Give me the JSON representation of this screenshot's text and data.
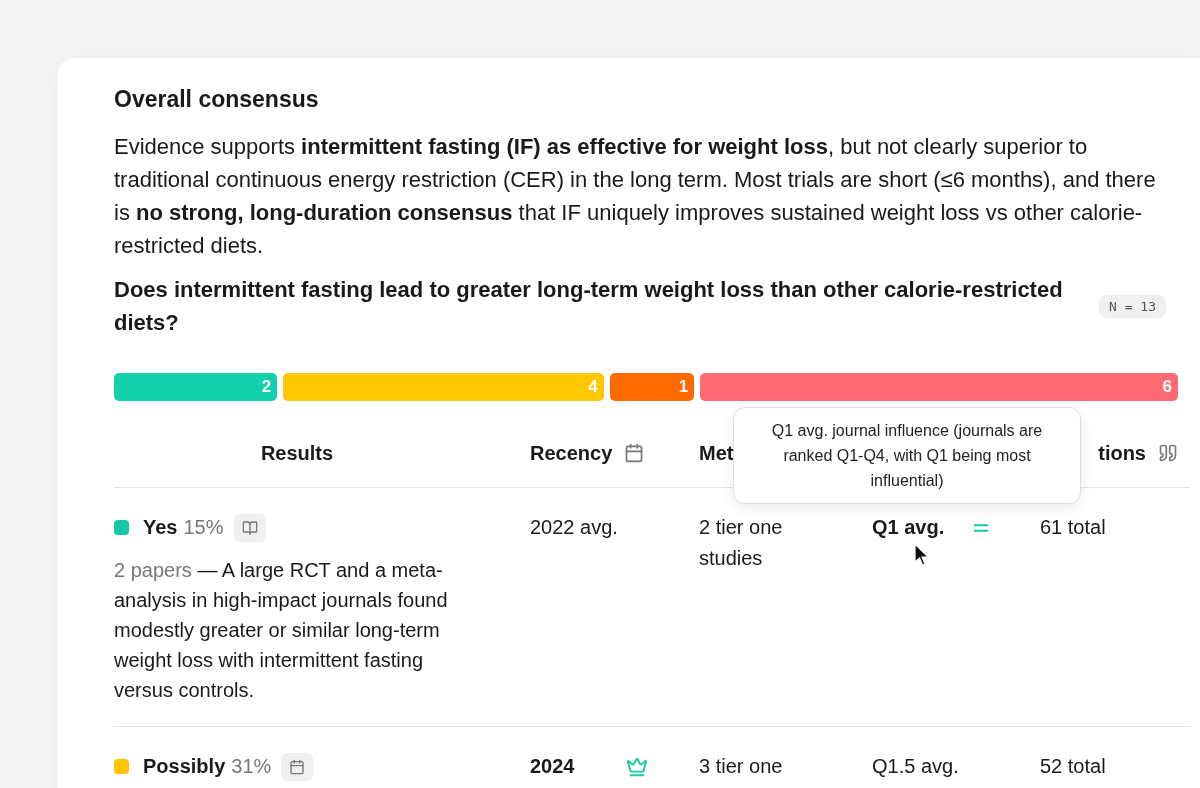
{
  "card": {
    "title": "Overall consensus",
    "summary": "Evidence supports **intermittent fasting (IF) as effective for weight loss**, but not clearly superior to traditional continuous energy restriction (CER) in the long term. Most trials are short (≤6 months), and there is **no strong, long-duration consensus** that IF uniquely improves sustained weight loss vs other calorie-restricted diets.",
    "question": "Does intermittent fasting lead to greater long-term weight loss than other calorie-restricted diets?",
    "n_badge": "N = 13"
  },
  "distribution": [
    {
      "count": "2",
      "color": "#14d1ae"
    },
    {
      "count": "4",
      "color": "#ffc700"
    },
    {
      "count": "1",
      "color": "#ff6a00"
    },
    {
      "count": "6",
      "color": "#ff6b73"
    }
  ],
  "table": {
    "columns": [
      "Results",
      "Recency",
      "Met",
      "tions"
    ],
    "rows": [
      {
        "answer": "Yes",
        "percent": "15%",
        "color": "#14c9a3",
        "recency": "2022 avg.",
        "recency_best": false,
        "methods": "2 tier one studies",
        "journal": "Q1 avg.",
        "journal_best": true,
        "citations": "61 total",
        "papers": "2 papers",
        "summary": "— A large RCT and a meta-analysis in high-impact journals found modestly greater or similar long-term weight loss with intermittent fasting versus controls."
      },
      {
        "answer": "Possibly",
        "percent": "31%",
        "color": "#ffc400",
        "recency": "2024",
        "recency_best": true,
        "methods": "3 tier one",
        "journal": "Q1.5 avg.",
        "journal_best": false,
        "citations": "52 total"
      }
    ]
  },
  "tooltip": {
    "text": "Q1 avg. journal influence (journals are ranked Q1-Q4, with Q1 being most influential)"
  }
}
